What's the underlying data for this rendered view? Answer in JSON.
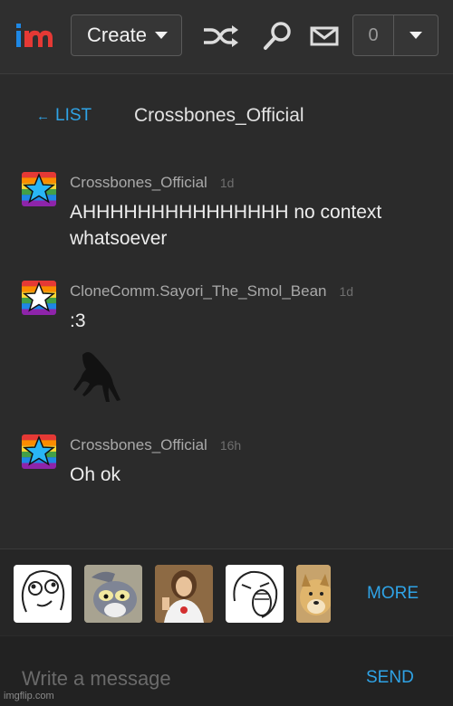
{
  "topbar": {
    "logo_icon": "imgflip-logo-icon",
    "create_label": "Create",
    "shuffle_icon": "shuffle-icon",
    "search_icon": "search-icon",
    "mail_icon": "mail-icon",
    "notification_count": "0"
  },
  "conversation": {
    "back_arrow": "←",
    "back_label": "LIST",
    "title": "Crossbones_Official"
  },
  "messages": [
    {
      "user": "Crossbones_Official",
      "time": "1d",
      "text": "AHHHHHHHHHHHHHHH no context whatsoever",
      "avatar_icon": "rainbow-star-avatar"
    },
    {
      "user": "CloneComm.Sayori_The_Smol_Bean",
      "time": "1d",
      "text": ":3",
      "avatar_icon": "rainbow-white-star-avatar",
      "image_icon": "dark-creature-image"
    },
    {
      "user": "Crossbones_Official",
      "time": "16h",
      "text": "Oh ok",
      "avatar_icon": "rainbow-star-avatar"
    }
  ],
  "meme_strip": {
    "more_label": "MORE",
    "memes": [
      "derp-face-meme",
      "unsettled-tom-meme",
      "buddy-christ-meme",
      "lol-face-meme",
      "doge-meme"
    ]
  },
  "compose": {
    "placeholder": "Write a message",
    "send_label": "SEND"
  },
  "watermark": "imgflip.com",
  "colors": {
    "accent": "#2fa3e6",
    "logo_blue": "#1e88e5",
    "logo_red": "#e53935"
  }
}
